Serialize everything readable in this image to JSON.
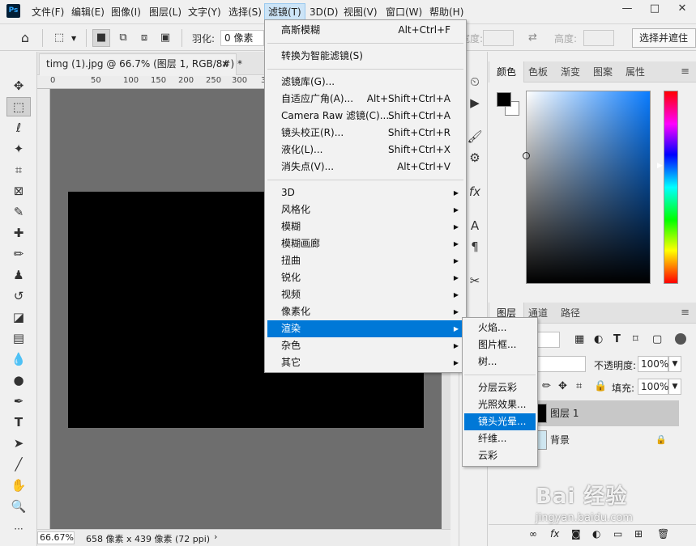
{
  "menubar": {
    "logo": "Ps",
    "items": [
      "文件(F)",
      "编辑(E)",
      "图像(I)",
      "图层(L)",
      "文字(Y)",
      "选择(S)",
      "滤镜(T)",
      "3D(D)",
      "视图(V)",
      "窗口(W)",
      "帮助(H)"
    ],
    "active_index": 6,
    "window_controls": [
      "—",
      "□",
      "✕"
    ]
  },
  "options_bar": {
    "home_icon": "home-icon",
    "feather_label": "羽化:",
    "feather_value": "0 像素",
    "width_label": "宽度:",
    "height_label": "高度:",
    "select_mask_button": "选择并遮住"
  },
  "document": {
    "tab_title": "timg (1).jpg @ 66.7% (图层 1, RGB/8#) *",
    "tab_close": "×",
    "ruler_ticks": [
      "0",
      "50",
      "100",
      "150",
      "200",
      "250",
      "300",
      "35"
    ],
    "zoom": "66.67%",
    "info": "658 像素 x 439 像素 (72 ppi)",
    "info_arrow": "›"
  },
  "filter_menu": {
    "top_items": [
      {
        "label": "高斯模糊",
        "shortcut": "Alt+Ctrl+F"
      },
      {
        "label": "转换为智能滤镜(S)",
        "shortcut": ""
      }
    ],
    "mid_items": [
      {
        "label": "滤镜库(G)...",
        "shortcut": ""
      },
      {
        "label": "自适应广角(A)...",
        "shortcut": "Alt+Shift+Ctrl+A"
      },
      {
        "label": "Camera Raw 滤镜(C)...",
        "shortcut": "Shift+Ctrl+A"
      },
      {
        "label": "镜头校正(R)...",
        "shortcut": "Shift+Ctrl+R"
      },
      {
        "label": "液化(L)...",
        "shortcut": "Shift+Ctrl+X"
      },
      {
        "label": "消失点(V)...",
        "shortcut": "Alt+Ctrl+V"
      }
    ],
    "sub_items": [
      "3D",
      "风格化",
      "模糊",
      "模糊画廊",
      "扭曲",
      "锐化",
      "视频",
      "像素化",
      "渲染",
      "杂色",
      "其它"
    ],
    "highlighted": "渲染",
    "submenu_arrow": "▶"
  },
  "render_submenu": {
    "group1": [
      "火焰...",
      "图片框...",
      "树..."
    ],
    "group2": [
      "分层云彩",
      "光照效果...",
      "镜头光晕...",
      "纤维...",
      "云彩"
    ],
    "highlighted": "镜头光晕..."
  },
  "color_panel": {
    "tabs": [
      "颜色",
      "色板",
      "渐变",
      "图案",
      "属性"
    ],
    "active_tab": 0,
    "menu_icon": "≡",
    "foreground": "#000000",
    "background": "#ffffff",
    "hue_color": "#0a7cff"
  },
  "layers_panel": {
    "tabs": [
      "图层",
      "通道",
      "路径"
    ],
    "active_tab": 0,
    "menu_icon": "≡",
    "opacity_label": "不透明度:",
    "opacity_value": "100%",
    "fill_label": "填充:",
    "fill_value": "100%",
    "layers": [
      {
        "name": "图层 1",
        "selected": true
      },
      {
        "name": "背景",
        "locked": true
      }
    ],
    "lock_icon": "🔒"
  },
  "watermark": {
    "title": "Bai 经验",
    "url": "jingyan.baidu.com"
  }
}
